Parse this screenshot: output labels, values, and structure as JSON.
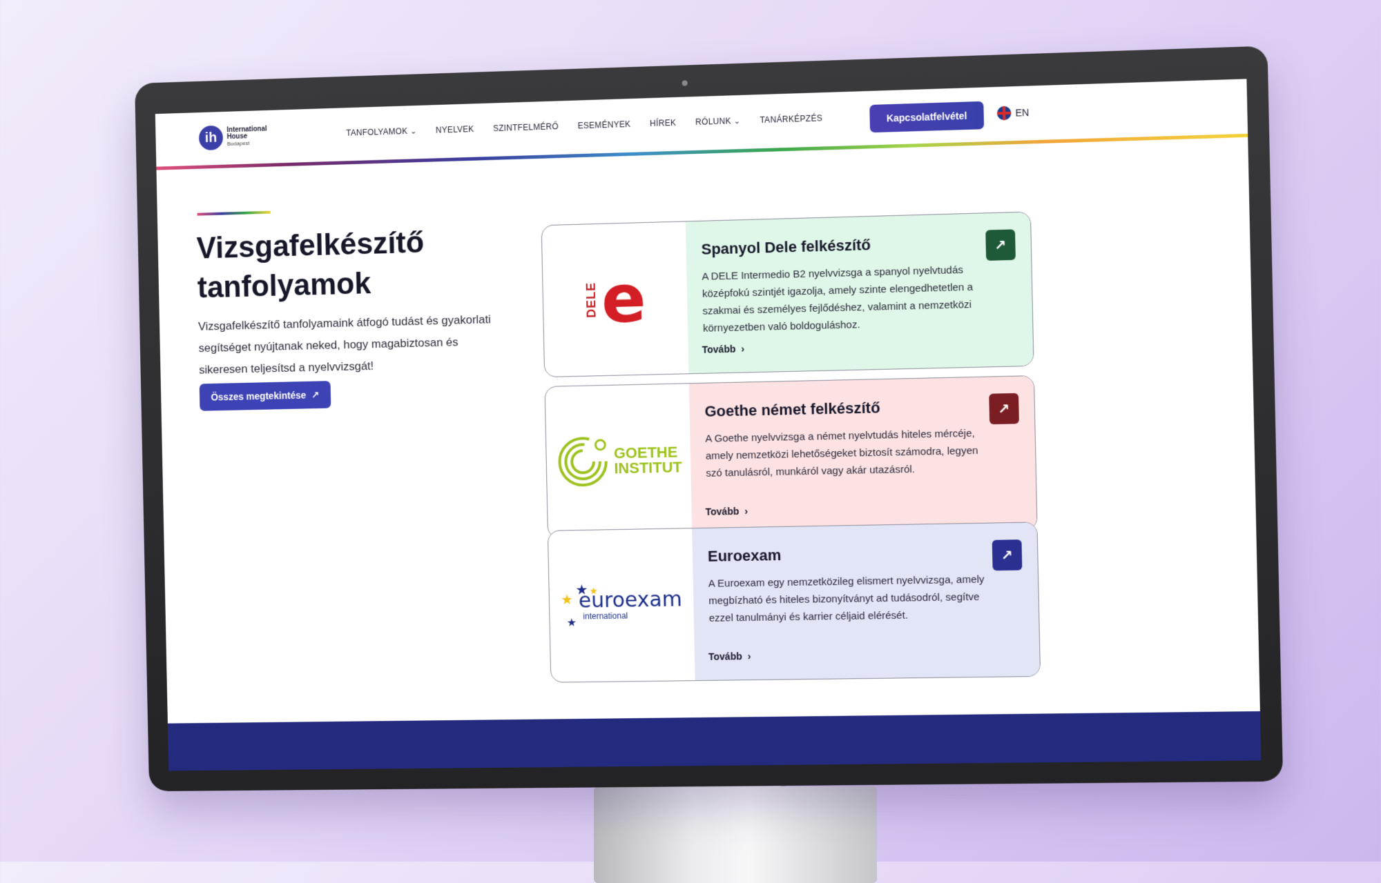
{
  "header": {
    "logo": {
      "badge": "ih",
      "line1": "International",
      "line2": "House",
      "line3": "Budapest"
    },
    "nav": [
      {
        "label": "TANFOLYAMOK",
        "has_dropdown": true
      },
      {
        "label": "NYELVEK",
        "has_dropdown": false
      },
      {
        "label": "SZINTFELMÉRŐ",
        "has_dropdown": false
      },
      {
        "label": "ESEMÉNYEK",
        "has_dropdown": false
      },
      {
        "label": "HÍREK",
        "has_dropdown": false
      },
      {
        "label": "RÓLUNK",
        "has_dropdown": true
      },
      {
        "label": "TANÁRKÉPZÉS",
        "has_dropdown": false
      }
    ],
    "contact_button": "Kapcsolatfelvétel",
    "language": "EN"
  },
  "hero": {
    "title": "Vizsgafelkészítő tanfolyamok",
    "description": "Vizsgafelkészítő tanfolyamaink átfogó tudást és gyakorlati segítséget nyújtanak neked, hogy magabiztosan és sikeresen teljesítsd a nyelvvizsgát!",
    "button": "Összes megtekintése"
  },
  "cards": [
    {
      "title": "Spanyol Dele felkészítő",
      "description": "A DELE Intermedio B2 nyelvvizsga a spanyol nyelvtudás középfokú szintjét igazolja, amely szinte elengedhetetlen a szakmai és személyes fejlődéshez, valamint a nemzetközi környezetben való boldoguláshoz.",
      "link": "Tovább",
      "logo_text": "DELE",
      "logo_letter": "e",
      "accent": "#1f5a38"
    },
    {
      "title": "Goethe német felkészítő",
      "description": "A Goethe nyelvvizsga a német nyelvtudás hiteles mércéje, amely nemzetközi lehetőségeket biztosít számodra, legyen szó tanulásról, munkáról vagy akár utazásról.",
      "link": "Tovább",
      "logo_line1": "GOETHE",
      "logo_line2": "INSTITUT",
      "accent": "#7a1e24"
    },
    {
      "title": "Euroexam",
      "description": "A Euroexam egy nemzetközileg elismert nyelvvizsga, amely megbízható és hiteles bizonyítványt ad tudásodról, segítve ezzel tanulmányi és karrier céljaid elérését.",
      "link": "Tovább",
      "logo_word": "euroexam",
      "logo_sub": "international",
      "accent": "#2b2f8f"
    }
  ],
  "colors": {
    "primary": "#3d43b4",
    "footer": "#242a7e"
  }
}
